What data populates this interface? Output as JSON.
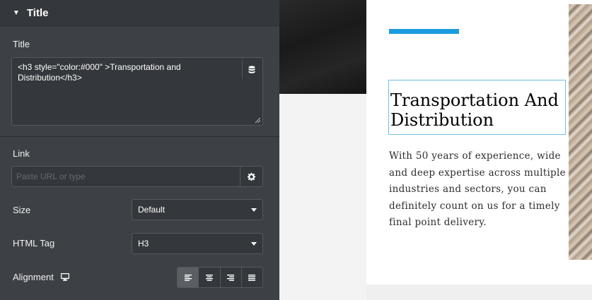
{
  "panel": {
    "section_title": "Title",
    "title_field": {
      "label": "Title",
      "value": "<h3 style=\"color:#000\" >Transportation and Distribution</h3>"
    },
    "link_field": {
      "label": "Link",
      "placeholder": "Paste URL or type"
    },
    "size_field": {
      "label": "Size",
      "value": "Default"
    },
    "html_tag_field": {
      "label": "HTML Tag",
      "value": "H3"
    },
    "alignment_field": {
      "label": "Alignment",
      "options": [
        "left",
        "center",
        "right",
        "justify"
      ],
      "selected": "left"
    }
  },
  "preview": {
    "heading": "Transportation And Distribution",
    "body": "With 50 years of experience, wide and deep expertise across multiple industries and sectors, you can definitely count on us for a timely final point delivery.",
    "accent_color": "#1e9be0"
  },
  "colors": {
    "panel_bg": "#3d4146",
    "input_bg": "#34383c",
    "selection_outline": "#6ec1e4"
  }
}
